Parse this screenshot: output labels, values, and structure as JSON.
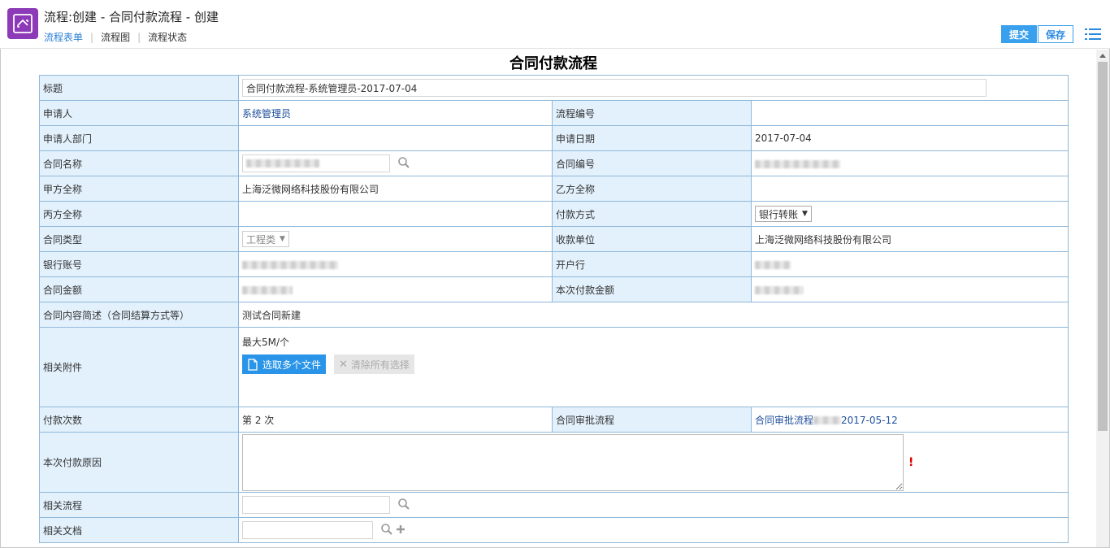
{
  "header": {
    "title": "流程:创建 - 合同付款流程 - 创建",
    "tabs": [
      "流程表单",
      "流程图",
      "流程状态"
    ],
    "submit_label": "提交",
    "save_label": "保存"
  },
  "form": {
    "title": "合同付款流程",
    "fields": {
      "title_label": "标题",
      "title_value": "合同付款流程-系统管理员-2017-07-04",
      "applicant_label": "申请人",
      "applicant_value": "系统管理员",
      "flow_no_label": "流程编号",
      "dept_label": "申请人部门",
      "apply_date_label": "申请日期",
      "apply_date_value": "2017-07-04",
      "contract_name_label": "合同名称",
      "contract_no_label": "合同编号",
      "party_a_label": "甲方全称",
      "party_a_value": "上海泛微网络科技股份有限公司",
      "party_b_label": "乙方全称",
      "party_c_label": "丙方全称",
      "pay_method_label": "付款方式",
      "pay_method_value": "银行转账",
      "contract_type_label": "合同类型",
      "contract_type_value": "工程类",
      "payee_label": "收款单位",
      "payee_value": "上海泛微网络科技股份有限公司",
      "bank_account_label": "银行账号",
      "bank_label": "开户行",
      "amount_label": "合同金额",
      "this_amount_label": "本次付款金额",
      "content_label": "合同内容简述（合同结算方式等）",
      "content_value": "测试合同新建",
      "attach_label": "相关附件",
      "attach_limit": "最大5M/个",
      "pick_files_label": "选取多个文件",
      "clear_all_label": "清除所有选择",
      "pay_count_label": "付款次数",
      "pay_count_value": "第 2 次",
      "approval_flow_label": "合同审批流程",
      "approval_flow_prefix": "合同审批流程",
      "approval_flow_date": "2017-05-12",
      "reason_label": "本次付款原因",
      "required_mark": "!",
      "related_flow_label": "相关流程",
      "related_doc_label": "相关文档"
    }
  }
}
